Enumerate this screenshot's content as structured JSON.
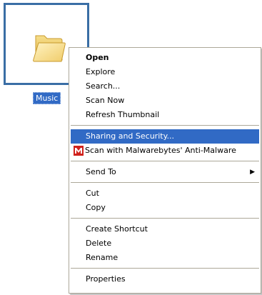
{
  "desktop": {
    "folder_label": "Music"
  },
  "context_menu": {
    "items": {
      "open": "Open",
      "explore": "Explore",
      "search": "Search...",
      "scan_now": "Scan Now",
      "refresh_thumbnail": "Refresh Thumbnail",
      "sharing_security": "Sharing and Security...",
      "scan_malwarebytes": "Scan with Malwarebytes' Anti-Malware",
      "send_to": "Send To",
      "cut": "Cut",
      "copy": "Copy",
      "create_shortcut": "Create Shortcut",
      "delete": "Delete",
      "rename": "Rename",
      "properties": "Properties"
    },
    "highlight_color": "#316ac5",
    "submenu_arrow_icon": "triangle-right-icon",
    "malwarebytes_icon": "malwarebytes-icon"
  }
}
